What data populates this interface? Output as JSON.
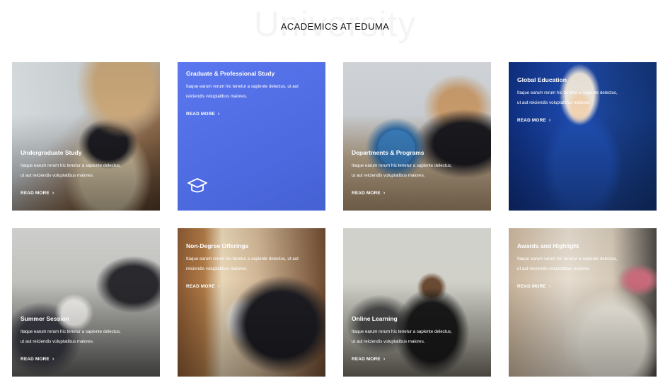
{
  "header": {
    "bg_word": "University",
    "title": "ACADEMICS AT EDUMA"
  },
  "colors": {
    "accent_blue": "#4f6fe6",
    "text_white": "#ffffff",
    "title_dark": "#111111"
  },
  "cards": [
    {
      "title": "Undergraduate Study",
      "desc_line1": "Itaque earum rerum hic tenetur a sapiente delectus,",
      "desc_line2": "ut aut reiciendis voluptatibus maiores.",
      "more": "READ MORE"
    },
    {
      "title": "Graduate & Professional Study",
      "desc_line1": "Itaque earum rerum hic tenetur a sapiente delectus, ut aut",
      "desc_line2": "reiciendis voluptatibus maiores.",
      "more": "READ MORE",
      "icon": "graduation-cap-icon"
    },
    {
      "title": "Departments & Programs",
      "desc_line1": "Itaque earum rerum hic tenetur a sapiente delectus,",
      "desc_line2": "ut aut reiciendis voluptatibus maiores.",
      "more": "READ MORE"
    },
    {
      "title": "Global Education",
      "desc_line1": "Itaque earum rerum hic tenetur a sapiente delectus,",
      "desc_line2": "ut aut reiciendis voluptatibus maiores.",
      "more": "READ MORE"
    },
    {
      "title": "Summer Session",
      "desc_line1": "Itaque earum rerum hic tenetur a sapiente delectus,",
      "desc_line2": "ut aut reiciendis voluptatibus maiores.",
      "more": "READ MORE"
    },
    {
      "title": "Non-Degree Offerings",
      "desc_line1": "Itaque earum rerum hic tenetur a sapiente delectus, ut aut",
      "desc_line2": "reiciendis voluptatibus maiores.",
      "more": "READ MORE"
    },
    {
      "title": "Online Learning",
      "desc_line1": "Itaque earum rerum hic tenetur a sapiente delectus,",
      "desc_line2": "ut aut reiciendis voluptatibus maiores.",
      "more": "READ MORE"
    },
    {
      "title": "Awards and Highlight",
      "desc_line1": "Itaque earum rerum hic tenetur a sapiente delectus,",
      "desc_line2": "ut aut reiciendis voluptatibus maiores.",
      "more": "READ MORE"
    }
  ]
}
